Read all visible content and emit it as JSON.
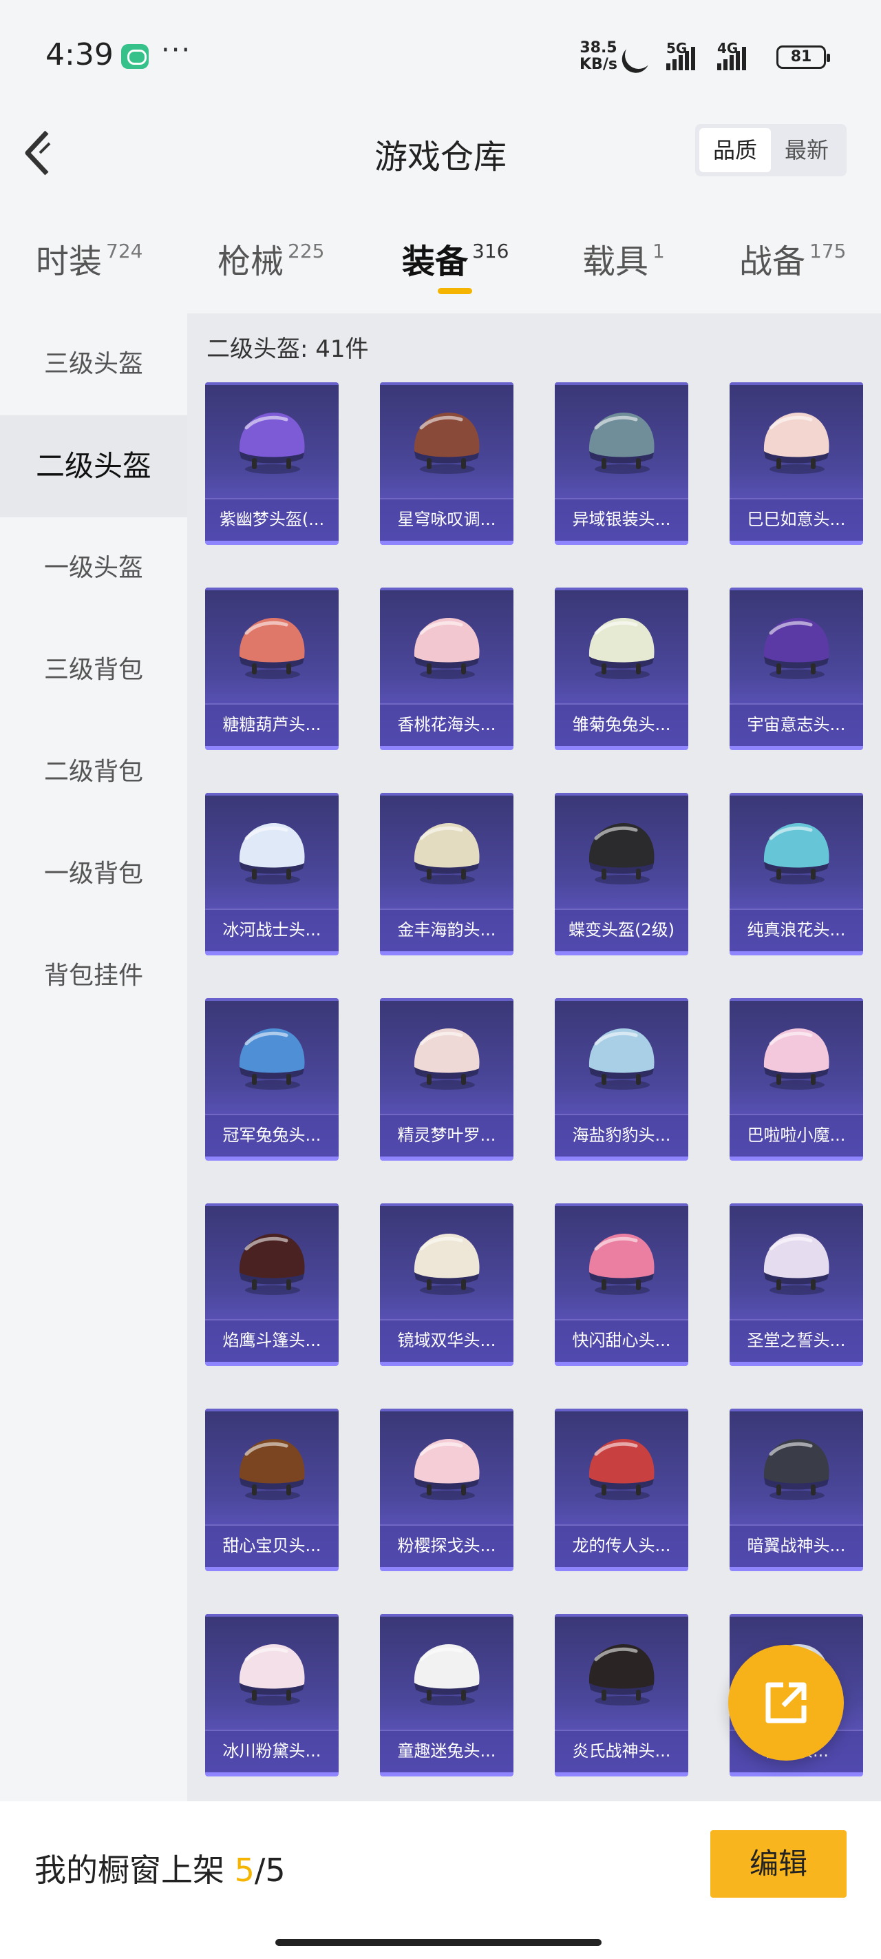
{
  "status_bar": {
    "time": "4:39",
    "net_speed": "38.5",
    "net_unit": "KB/s",
    "sim1": "5G",
    "sim2": "4G",
    "battery": "81"
  },
  "header": {
    "title": "游戏仓库",
    "sort": [
      {
        "label": "品质",
        "active": true
      },
      {
        "label": "最新",
        "active": false
      }
    ]
  },
  "categories": [
    {
      "label": "时装",
      "count": "724"
    },
    {
      "label": "枪械",
      "count": "225"
    },
    {
      "label": "装备",
      "count": "316",
      "active": true
    },
    {
      "label": "载具",
      "count": "1"
    },
    {
      "label": "战备",
      "count": "175"
    }
  ],
  "sidebar": {
    "items": [
      {
        "label": "三级头盔"
      },
      {
        "label": "二级头盔",
        "active": true
      },
      {
        "label": "一级头盔"
      },
      {
        "label": "三级背包"
      },
      {
        "label": "二级背包"
      },
      {
        "label": "一级背包"
      },
      {
        "label": "背包挂件"
      }
    ]
  },
  "content": {
    "title": "二级头盔: 41件",
    "items": [
      {
        "name": "紫幽梦头盔(...",
        "color": "#7d5ad6"
      },
      {
        "name": "星穹咏叹调...",
        "color": "#8a4a3a"
      },
      {
        "name": "异域银装头...",
        "color": "#6f8e9a"
      },
      {
        "name": "巳巳如意头...",
        "color": "#f2d6cf"
      },
      {
        "name": "糖糖葫芦头...",
        "color": "#e0786a"
      },
      {
        "name": "香桃花海头...",
        "color": "#f3c7cf"
      },
      {
        "name": "雏菊兔兔头...",
        "color": "#e6ead2"
      },
      {
        "name": "宇宙意志头...",
        "color": "#5b3aa6"
      },
      {
        "name": "冰河战士头...",
        "color": "#dfe9f7"
      },
      {
        "name": "金丰海韵头...",
        "color": "#e4dcc0"
      },
      {
        "name": "蝶变头盔(2级)",
        "color": "#2b2b2e"
      },
      {
        "name": "纯真浪花头...",
        "color": "#66c6d8"
      },
      {
        "name": "冠军兔兔头...",
        "color": "#4f8fd6"
      },
      {
        "name": "精灵梦叶罗...",
        "color": "#efd9d6"
      },
      {
        "name": "海盐豹豹头...",
        "color": "#a9cfe6"
      },
      {
        "name": "巴啦啦小魔...",
        "color": "#f4c8dc"
      },
      {
        "name": "焰鹰斗篷头...",
        "color": "#4a2222"
      },
      {
        "name": "镜域双华头...",
        "color": "#eee6d6"
      },
      {
        "name": "快闪甜心头...",
        "color": "#ea7fa1"
      },
      {
        "name": "圣堂之誓头...",
        "color": "#e6dcef"
      },
      {
        "name": "甜心宝贝头...",
        "color": "#7a4520"
      },
      {
        "name": "粉樱探戈头...",
        "color": "#f5cdd6"
      },
      {
        "name": "龙的传人头...",
        "color": "#c94040"
      },
      {
        "name": "暗翼战神头...",
        "color": "#3a3d48"
      },
      {
        "name": "冰川粉黛头...",
        "color": "#f3e0e8"
      },
      {
        "name": "童趣迷兔头...",
        "color": "#f2f2f2"
      },
      {
        "name": "炎氏战神头...",
        "color": "#2a2425"
      },
      {
        "name": "德...头...",
        "color": "#d8dde8"
      }
    ]
  },
  "bottom_bar": {
    "showcase_label": "我的橱窗上架",
    "showcase_current": "5",
    "showcase_total": "/5",
    "edit_label": "编辑"
  }
}
